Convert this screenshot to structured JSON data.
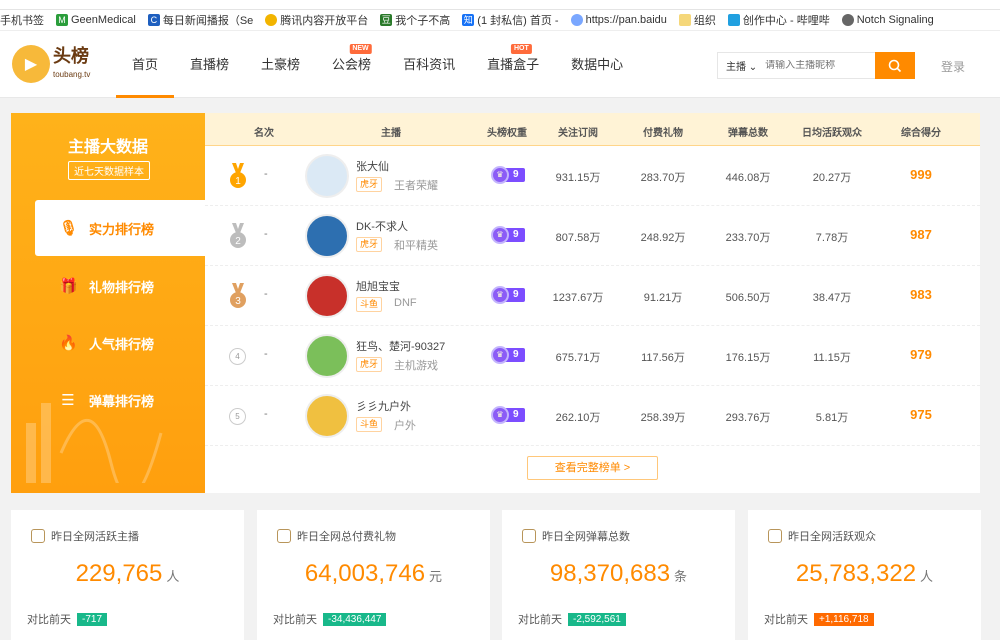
{
  "bookmarks": [
    "手机书签",
    "GeenMedical",
    "每日新闻播报（Se",
    "腾讯内容开放平台",
    "我个子不高",
    "(1 封私信) 首页 -",
    "https://pan.baidu",
    "组织",
    "创作中心 - 哔哩哔",
    "Notch Signaling"
  ],
  "header": {
    "logo_text": "头榜",
    "logo_sub": "toubang.tv",
    "nav": [
      {
        "label": "首页"
      },
      {
        "label": "直播榜"
      },
      {
        "label": "土豪榜"
      },
      {
        "label": "公会榜",
        "tag": "NEW"
      },
      {
        "label": "百科资讯"
      },
      {
        "label": "直播盒子",
        "tag": "HOT"
      },
      {
        "label": "数据中心"
      }
    ],
    "search_scope": "主播",
    "search_placeholder": "请输入主播昵称",
    "login": "登录"
  },
  "sidebar": {
    "title": "主播大数据",
    "badge": "近七天数据样本",
    "items": [
      "实力排行榜",
      "礼物排行榜",
      "人气排行榜",
      "弹幕排行榜"
    ]
  },
  "table": {
    "headers": [
      "名次",
      "主播",
      "头榜权重",
      "关注订阅",
      "付费礼物",
      "弹幕总数",
      "日均活跃观众",
      "综合得分"
    ],
    "rows": [
      {
        "rank": "1",
        "change": "-",
        "name": "张大仙",
        "platform": "虎牙",
        "game": "王者荣耀",
        "weight": "9",
        "follow": "931.15万",
        "gift": "283.70万",
        "danmu": "446.08万",
        "active": "20.27万",
        "score": "999"
      },
      {
        "rank": "2",
        "change": "-",
        "name": "DK-不求人",
        "platform": "虎牙",
        "game": "和平精英",
        "weight": "9",
        "follow": "807.58万",
        "gift": "248.92万",
        "danmu": "233.70万",
        "active": "7.78万",
        "score": "987"
      },
      {
        "rank": "3",
        "change": "-",
        "name": "旭旭宝宝",
        "platform": "斗鱼",
        "game": "DNF",
        "weight": "9",
        "follow": "1237.67万",
        "gift": "91.21万",
        "danmu": "506.50万",
        "active": "38.47万",
        "score": "983"
      },
      {
        "rank": "4",
        "change": "-",
        "name": "狂鸟、楚河-90327",
        "platform": "虎牙",
        "game": "主机游戏",
        "weight": "9",
        "follow": "675.71万",
        "gift": "117.56万",
        "danmu": "176.15万",
        "active": "11.15万",
        "score": "979"
      },
      {
        "rank": "5",
        "change": "-",
        "name": "彡彡九户外",
        "platform": "斗鱼",
        "game": "户外",
        "weight": "9",
        "follow": "262.10万",
        "gift": "258.39万",
        "danmu": "293.76万",
        "active": "5.81万",
        "score": "975"
      }
    ],
    "more": "查看完整榜单 >"
  },
  "cards": [
    {
      "title": "昨日全网活跃主播",
      "value": "229,765",
      "unit": "人",
      "compare": "对比前天",
      "delta": "-717",
      "dir": "down"
    },
    {
      "title": "昨日全网总付费礼物",
      "value": "64,003,746",
      "unit": "元",
      "compare": "对比前天",
      "delta": "-34,436,447",
      "dir": "down"
    },
    {
      "title": "昨日全网弹幕总数",
      "value": "98,370,683",
      "unit": "条",
      "compare": "对比前天",
      "delta": "-2,592,561",
      "dir": "down"
    },
    {
      "title": "昨日全网活跃观众",
      "value": "25,783,322",
      "unit": "人",
      "compare": "对比前天",
      "delta": "+1,116,718",
      "dir": "up"
    }
  ],
  "colors": {
    "accent": "#ff8a00",
    "down": "#18b88a",
    "up": "#ff6a00"
  }
}
